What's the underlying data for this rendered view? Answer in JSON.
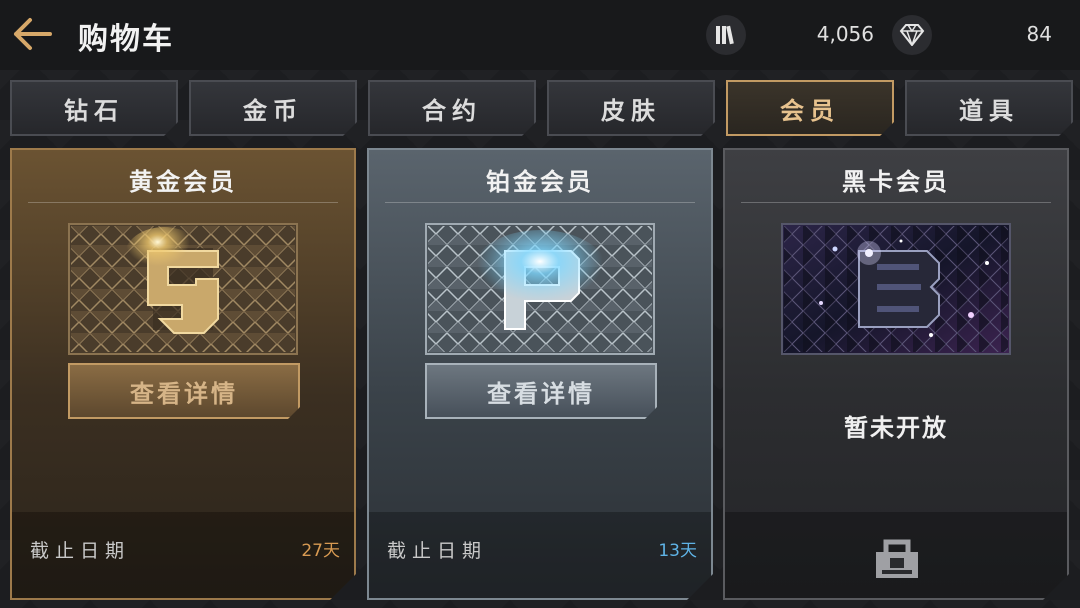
{
  "header": {
    "title": "购物车",
    "coins": "4,056",
    "diamonds": "84"
  },
  "tabs": [
    {
      "label": "钻石",
      "active": false
    },
    {
      "label": "金币",
      "active": false
    },
    {
      "label": "合约",
      "active": false
    },
    {
      "label": "皮肤",
      "active": false
    },
    {
      "label": "会员",
      "active": true
    },
    {
      "label": "道具",
      "active": false
    }
  ],
  "cards": {
    "gold": {
      "title": "黄金会员",
      "button": "查看详情",
      "deadline_label": "截止日期",
      "days_left": "27天"
    },
    "platinum": {
      "title": "铂金会员",
      "button": "查看详情",
      "deadline_label": "截止日期",
      "days_left": "13天"
    },
    "black": {
      "title": "黑卡会员",
      "status": "暂未开放"
    }
  },
  "colors": {
    "accent_gold": "#c29a63",
    "days_gold": "#d89a52",
    "days_platinum": "#5fb3e6",
    "background": "#1b1c1f"
  },
  "icons": {
    "back": "arrow-left-icon",
    "library": "library-icon",
    "diamond": "diamond-icon",
    "lock": "lock-icon"
  }
}
